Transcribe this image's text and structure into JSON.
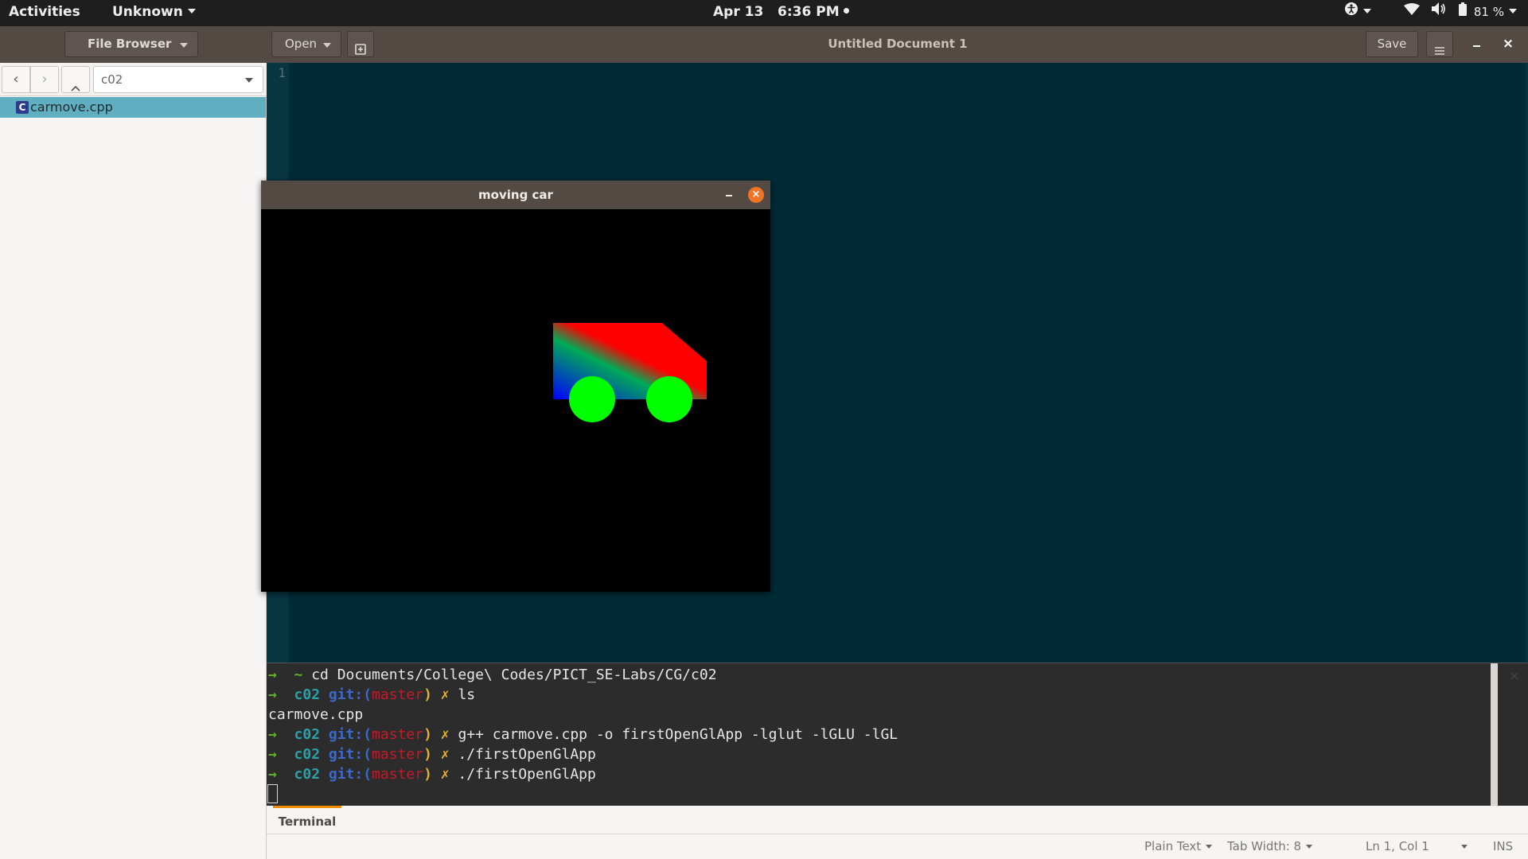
{
  "topbar": {
    "activities": "Activities",
    "app_name": "Unknown",
    "clock": "Apr 13   6:36 PM",
    "battery": "81 %",
    "icons": [
      "accessibility-icon",
      "wifi-icon",
      "volume-icon",
      "battery-icon"
    ]
  },
  "headerbar": {
    "file_browser_label": "File Browser",
    "open_label": "Open",
    "title": "Untitled Document 1",
    "save_label": "Save",
    "close_glyph": "×"
  },
  "side_panel": {
    "location": "c02",
    "files": [
      {
        "name": "carmove.cpp",
        "icon": "cpp-file-icon",
        "icon_letter": "C",
        "selected": true
      }
    ]
  },
  "editor": {
    "line_numbers": [
      "1"
    ],
    "content": "",
    "theme_bg": "#002b36"
  },
  "gl_window": {
    "title": "moving car",
    "close_glyph": "×",
    "car_colors": {
      "body_top": "#ff0000",
      "body_left": "#0000ff",
      "body_right": "#00aa55",
      "wheels": "#00ff00"
    }
  },
  "terminal": {
    "lines": [
      {
        "prompt": "→  ~",
        "dir": "",
        "git": "",
        "branch": "",
        "x": "",
        "cmd": " cd Documents/College\\ Codes/PICT_SE-Labs/CG/c02"
      },
      {
        "prompt": "→  ",
        "dir": "c02 ",
        "git": "git:(",
        "branch": "master",
        "x": ") ✗",
        "cmd": " ls"
      },
      {
        "prompt": "",
        "dir": "",
        "git": "",
        "branch": "",
        "x": "",
        "cmd": "carmove.cpp"
      },
      {
        "prompt": "→  ",
        "dir": "c02 ",
        "git": "git:(",
        "branch": "master",
        "x": ") ✗",
        "cmd": " g++ carmove.cpp -o firstOpenGlApp -lglut -lGLU -lGL"
      },
      {
        "prompt": "→  ",
        "dir": "c02 ",
        "git": "git:(",
        "branch": "master",
        "x": ") ✗",
        "cmd": " ./firstOpenGlApp"
      },
      {
        "prompt": "→  ",
        "dir": "c02 ",
        "git": "git:(",
        "branch": "master",
        "x": ") ✗",
        "cmd": " ./firstOpenGlApp"
      }
    ],
    "tab_label": "Terminal",
    "close_glyph": "×"
  },
  "statusbar": {
    "language": "Plain Text",
    "tab_width": "Tab Width: 8",
    "position": "Ln 1, Col 1",
    "mode": "INS"
  }
}
